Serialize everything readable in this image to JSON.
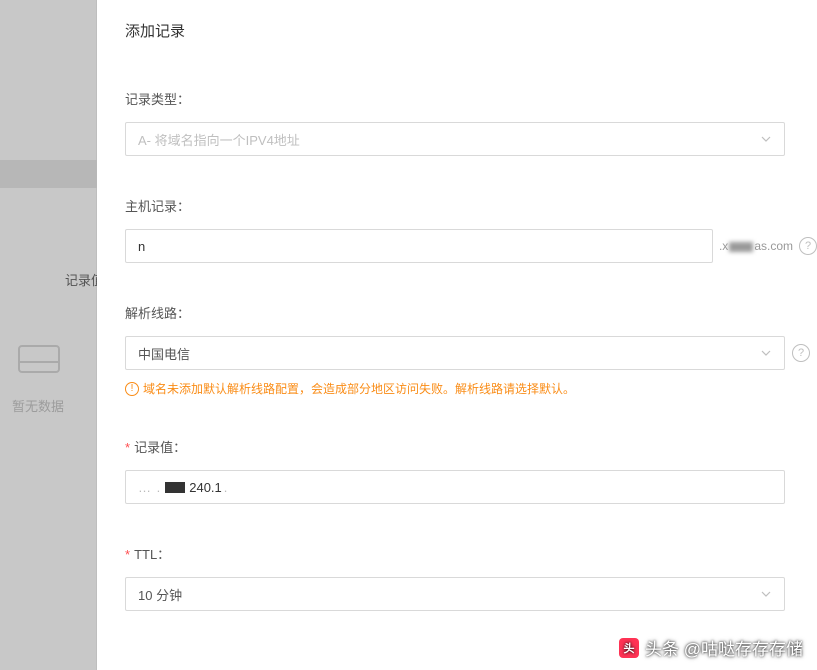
{
  "background": {
    "tab_label": "记录值",
    "no_data": "暂无数据"
  },
  "modal": {
    "title": "添加记录",
    "fields": {
      "record_type": {
        "label": "记录类型：",
        "value": "A- 将域名指向一个IPV4地址"
      },
      "host_record": {
        "label": "主机记录：",
        "value": "n",
        "suffix_prefix": ".x",
        "suffix_end": "as.com"
      },
      "resolve_line": {
        "label": "解析线路：",
        "value": "中国电信",
        "warning": "域名未添加默认解析线路配置，会造成部分地区访问失败。解析线路请选择默认。"
      },
      "record_value": {
        "label": "记录值：",
        "required": true,
        "value_suffix": "240.1"
      },
      "ttl": {
        "label": "TTL：",
        "required": true,
        "value": "10 分钟"
      }
    }
  },
  "watermark": "头条 @咕哒存存存储"
}
